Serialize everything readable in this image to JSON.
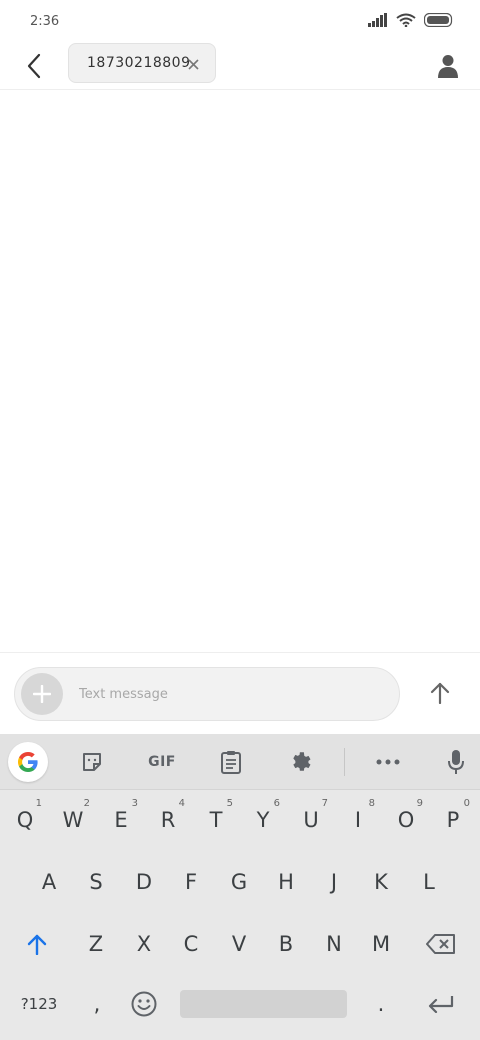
{
  "status_bar": {
    "time": "2:36",
    "icons": [
      "signal-icon",
      "wifi-icon",
      "battery-icon"
    ]
  },
  "header": {
    "back_icon": "back-arrow-icon",
    "recipient": "18730218809",
    "chip_close_icon": "close-icon",
    "contact_icon": "person-icon"
  },
  "composer": {
    "placeholder": "Text message",
    "value": "",
    "attach_icon": "plus-icon",
    "send_icon": "arrow-up-icon"
  },
  "keyboard": {
    "toolbar": {
      "items": [
        "google-icon",
        "sticker-icon",
        "gif",
        "clipboard-icon",
        "gear-icon",
        "more-icon",
        "mic-icon"
      ],
      "gif_label": "GIF"
    },
    "row1": [
      {
        "key": "Q",
        "hint": "1"
      },
      {
        "key": "W",
        "hint": "2"
      },
      {
        "key": "E",
        "hint": "3"
      },
      {
        "key": "R",
        "hint": "4"
      },
      {
        "key": "T",
        "hint": "5"
      },
      {
        "key": "Y",
        "hint": "6"
      },
      {
        "key": "U",
        "hint": "7"
      },
      {
        "key": "I",
        "hint": "8"
      },
      {
        "key": "O",
        "hint": "9"
      },
      {
        "key": "P",
        "hint": "0"
      }
    ],
    "row2": [
      "A",
      "S",
      "D",
      "F",
      "G",
      "H",
      "J",
      "K",
      "L"
    ],
    "row3": [
      "Z",
      "X",
      "C",
      "V",
      "B",
      "N",
      "M"
    ],
    "row4": {
      "symbols": "?123",
      "comma": ",",
      "period": "."
    },
    "accent_color": "#1a73e8"
  }
}
